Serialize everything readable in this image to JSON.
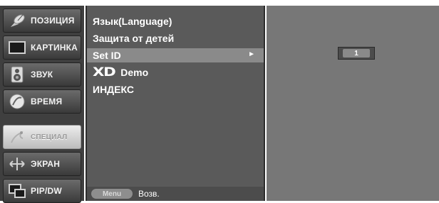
{
  "categories": [
    {
      "label": "ПОЗИЦИЯ",
      "icon": "satellite-dish-icon",
      "active": false
    },
    {
      "label": "КАРТИНКА",
      "icon": "picture-screen-icon",
      "active": false
    },
    {
      "label": "ЗВУК",
      "icon": "speaker-icon",
      "active": false
    },
    {
      "label": "ВРЕМЯ",
      "icon": "clock-icon",
      "active": false
    },
    {
      "label": "СПЕЦИАЛ",
      "icon": "special-swirl-icon",
      "active": true
    },
    {
      "label": "ЭКРАН",
      "icon": "screen-arrows-icon",
      "active": false
    },
    {
      "label": "PIP/DW",
      "icon": "pip-windows-icon",
      "active": false
    }
  ],
  "submenu": {
    "items": [
      {
        "label": "Язык(Language)"
      },
      {
        "label": "Защита от детей"
      },
      {
        "label": "Set ID",
        "selected": true,
        "arrow": "►"
      },
      {
        "logo": "XD",
        "label": "Demo"
      },
      {
        "label": "ИНДЕКС"
      }
    ],
    "footer": {
      "key_label": "Menu",
      "action_label": "Возв."
    }
  },
  "value_panel": {
    "set_id_value": "1"
  },
  "colors": {
    "menu_bg": "#5a5a5a",
    "selected_bg": "#8a8a8a",
    "value_bg": "#777777",
    "category_bg": "#3f3f3f"
  }
}
